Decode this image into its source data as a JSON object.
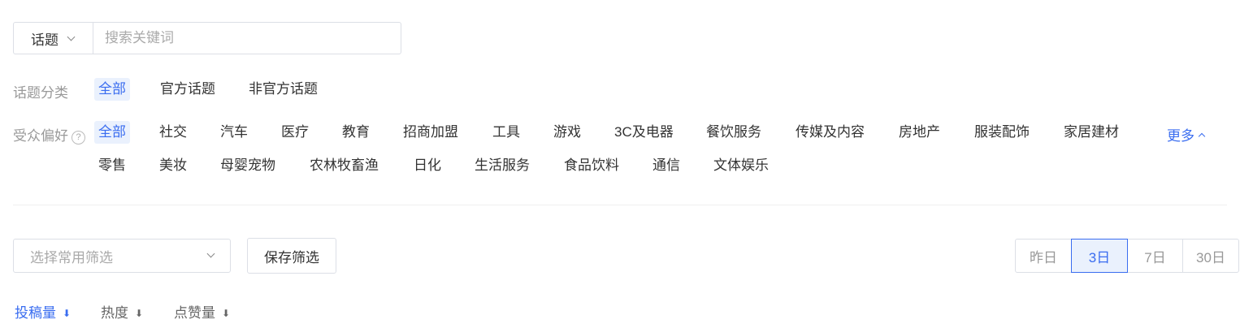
{
  "search": {
    "type_label": "话题",
    "placeholder": "搜索关键词"
  },
  "topic_category": {
    "label": "话题分类",
    "options": [
      "全部",
      "官方话题",
      "非官方话题"
    ],
    "selected": "全部"
  },
  "audience": {
    "label": "受众偏好",
    "help_icon_text": "?",
    "more_label": "更多",
    "row1": [
      "全部",
      "社交",
      "汽车",
      "医疗",
      "教育",
      "招商加盟",
      "工具",
      "游戏",
      "3C及电器",
      "餐饮服务",
      "传媒及内容",
      "房地产",
      "服装配饰",
      "家居建材"
    ],
    "row2": [
      "零售",
      "美妆",
      "母婴宠物",
      "农林牧畜渔",
      "日化",
      "生活服务",
      "食品饮料",
      "通信",
      "文体娱乐"
    ],
    "selected": "全部"
  },
  "filter": {
    "select_placeholder": "选择常用筛选",
    "save_label": "保存筛选"
  },
  "date_range": {
    "options": [
      "昨日",
      "3日",
      "7日",
      "30日"
    ],
    "selected": "3日"
  },
  "sort": {
    "options": [
      {
        "label": "投稿量",
        "arrow": "⬇"
      },
      {
        "label": "热度",
        "arrow": "⬇"
      },
      {
        "label": "点赞量",
        "arrow": "⬇"
      }
    ],
    "selected": "投稿量"
  },
  "colors": {
    "accent": "#3a6df0",
    "accent_bg": "#eaf1fd",
    "border": "#dcdfe6"
  }
}
